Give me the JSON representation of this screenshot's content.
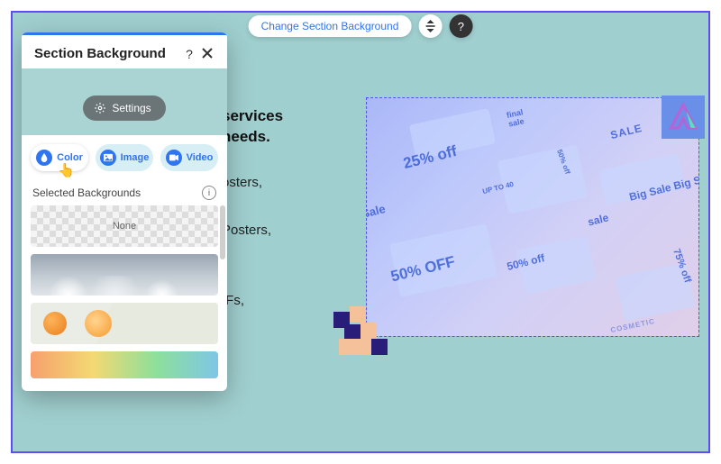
{
  "toolbar": {
    "change_bg_label": "Change Section Background"
  },
  "panel": {
    "title": "Section Background",
    "settings_label": "Settings",
    "tabs": {
      "color": "Color",
      "image": "Image",
      "video": "Video"
    },
    "selected_label": "Selected Backgrounds",
    "thumbs": {
      "none_label": "None"
    }
  },
  "section": {
    "heading_line1": "services",
    "heading_line2": "needs.",
    "body_line1": "osters,",
    "body_line2": "Posters,",
    "body_line3": ",",
    "body_line4": "IFs,"
  },
  "hero": {
    "labels": {
      "final_sale": "final\nsale",
      "p25": "25% off",
      "sale": "SALE",
      "big_sale": "Big Sale Big Sal",
      "sale_small": "sale",
      "p50_off": "50% OFF",
      "p50": "50% off",
      "p75": "75% off",
      "cosmetic": "COSMETIC",
      "p50v": "50% off",
      "upto40": "UP TO 40",
      "sale_left": "Sale"
    }
  }
}
